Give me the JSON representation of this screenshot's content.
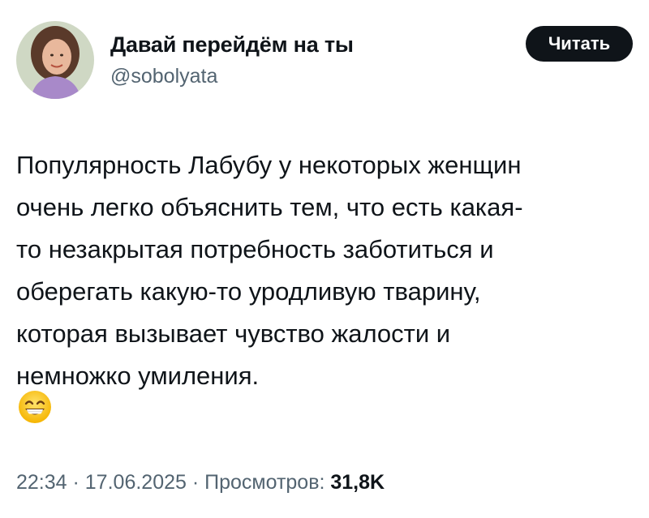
{
  "author": {
    "display_name": "Давай перейдём на ты",
    "handle": "@sobolyata"
  },
  "follow_button": {
    "label": "Читать"
  },
  "tweet": {
    "lines": [
      "Популярность Лабубу у некоторых женщин",
      "очень легко объяснить тем, что есть какая-",
      "то незакрытая потребность заботиться и",
      "оберегать какую-то уродливую тварину,",
      "которая вызывает чувство жалости и",
      "немножко умиления."
    ],
    "emoji_icon": "grinning-smiling-eyes-emoji"
  },
  "meta": {
    "time": "22:34",
    "separator1": " · ",
    "date": "17.06.2025",
    "separator2": " · ",
    "views_label": "Просмотров: ",
    "views_count": "31,8K"
  },
  "colors": {
    "text": "#0f1419",
    "secondary": "#536471",
    "button_bg": "#0f1419",
    "button_text": "#ffffff"
  }
}
